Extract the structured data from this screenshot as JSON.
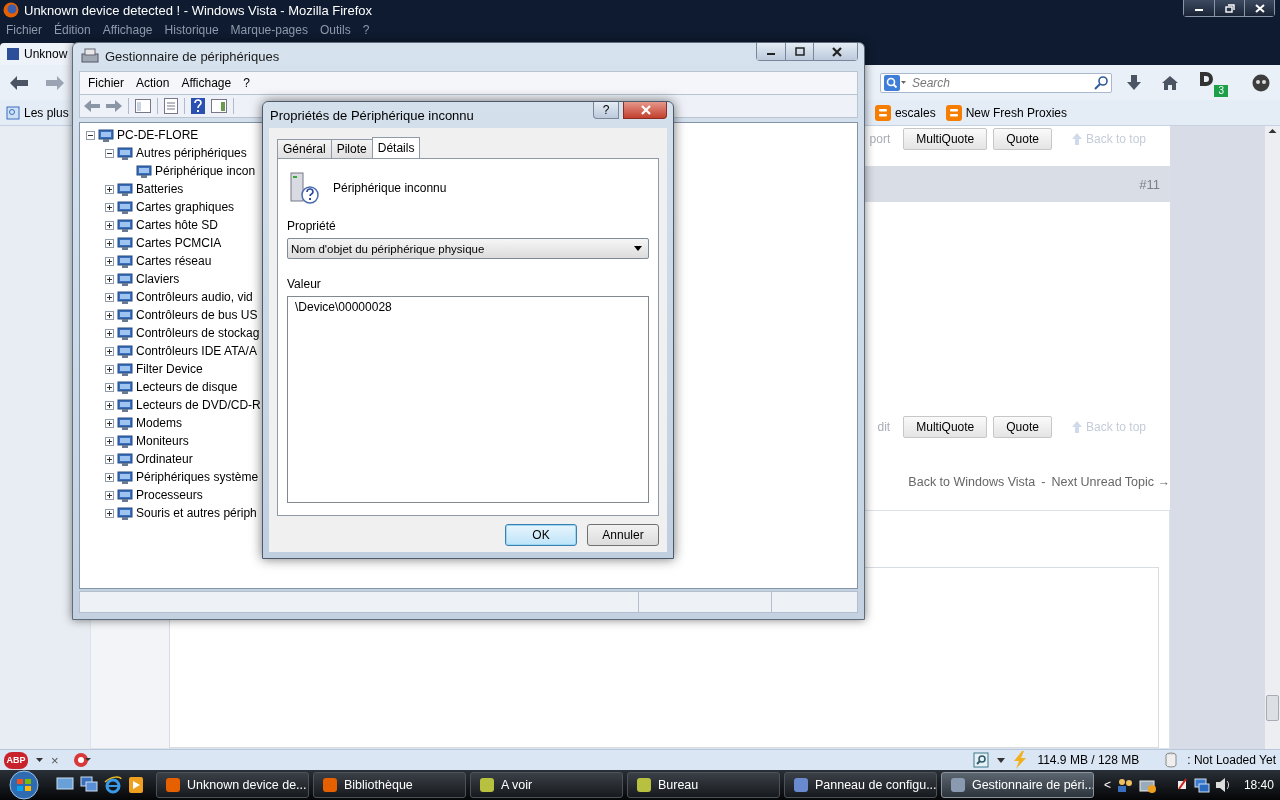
{
  "browser": {
    "title": "Unknown device detected ! - Windows Vista - Mozilla Firefox",
    "menu": [
      "Fichier",
      "Édition",
      "Affichage",
      "Historique",
      "Marque-pages",
      "Outils",
      "?"
    ],
    "tab": "Unknow",
    "search_placeholder": "Search",
    "badge": "3",
    "bookmarks": [
      "Les plus",
      "escales",
      "New Fresh Proxies"
    ],
    "posts": [
      {
        "cut_link": "port",
        "buttons": [
          "MultiQuote",
          "Quote"
        ],
        "back_to_top": "Back to top"
      },
      {
        "cut_link": "dit",
        "buttons": [
          "MultiQuote",
          "Quote"
        ],
        "back_to_top": "Back to top"
      }
    ],
    "post_number": "#11",
    "topic_nav": {
      "back": "Back to Windows Vista",
      "separator": "-",
      "next": "Next Unread Topic →"
    }
  },
  "addon_bar": {
    "abp": "ABP",
    "close": "×",
    "memory": "114.9 MB / 128 MB",
    "status": ": Not Loaded Yet"
  },
  "device_manager": {
    "title": "Gestionnaire de périphériques",
    "menu": [
      "Fichier",
      "Action",
      "Affichage",
      "?"
    ],
    "tree": {
      "label": "PC-DE-FLORE",
      "expanded": true,
      "children": [
        {
          "label": "Autres périphériques",
          "expanded": true,
          "children": [
            {
              "label": "Périphérique incon"
            }
          ]
        },
        {
          "label": "Batteries",
          "expanded": false
        },
        {
          "label": "Cartes graphiques",
          "expanded": false
        },
        {
          "label": "Cartes hôte SD",
          "expanded": false
        },
        {
          "label": "Cartes PCMCIA",
          "expanded": false
        },
        {
          "label": "Cartes réseau",
          "expanded": false
        },
        {
          "label": "Claviers",
          "expanded": false
        },
        {
          "label": "Contrôleurs audio, vid",
          "expanded": false
        },
        {
          "label": "Contrôleurs de bus US",
          "expanded": false
        },
        {
          "label": "Contrôleurs de stockag",
          "expanded": false
        },
        {
          "label": "Contrôleurs IDE ATA/A",
          "expanded": false
        },
        {
          "label": "Filter Device",
          "expanded": false
        },
        {
          "label": "Lecteurs de disque",
          "expanded": false
        },
        {
          "label": "Lecteurs de DVD/CD-R",
          "expanded": false
        },
        {
          "label": "Modems",
          "expanded": false
        },
        {
          "label": "Moniteurs",
          "expanded": false
        },
        {
          "label": "Ordinateur",
          "expanded": false
        },
        {
          "label": "Périphériques système",
          "expanded": false
        },
        {
          "label": "Processeurs",
          "expanded": false
        },
        {
          "label": "Souris et autres périph",
          "expanded": false
        }
      ]
    }
  },
  "dialog": {
    "title": "Propriétés de Périphérique inconnu",
    "help": "?",
    "tabs": [
      {
        "label": "Général",
        "selected": false
      },
      {
        "label": "Pilote",
        "selected": false
      },
      {
        "label": "Détails",
        "selected": true
      }
    ],
    "device_name": "Périphérique inconnu",
    "property_label": "Propriété",
    "property_value": "Nom d'objet du périphérique physique",
    "value_label": "Valeur",
    "values": [
      "\\Device\\00000028"
    ],
    "buttons": [
      {
        "label": "OK",
        "default": true
      },
      {
        "label": "Annuler",
        "default": false
      }
    ]
  },
  "taskbar": {
    "tasks": [
      {
        "label": "Unknown device de...",
        "selected": false
      },
      {
        "label": "Bibliothèque",
        "selected": false
      },
      {
        "label": "A voir",
        "selected": false
      },
      {
        "label": "Bureau",
        "selected": false
      },
      {
        "label": "Panneau de configu...",
        "selected": false
      },
      {
        "label": "Gestionnaire de péri...",
        "selected": true
      }
    ],
    "tray_arrow": "<",
    "clock": "18:40"
  }
}
